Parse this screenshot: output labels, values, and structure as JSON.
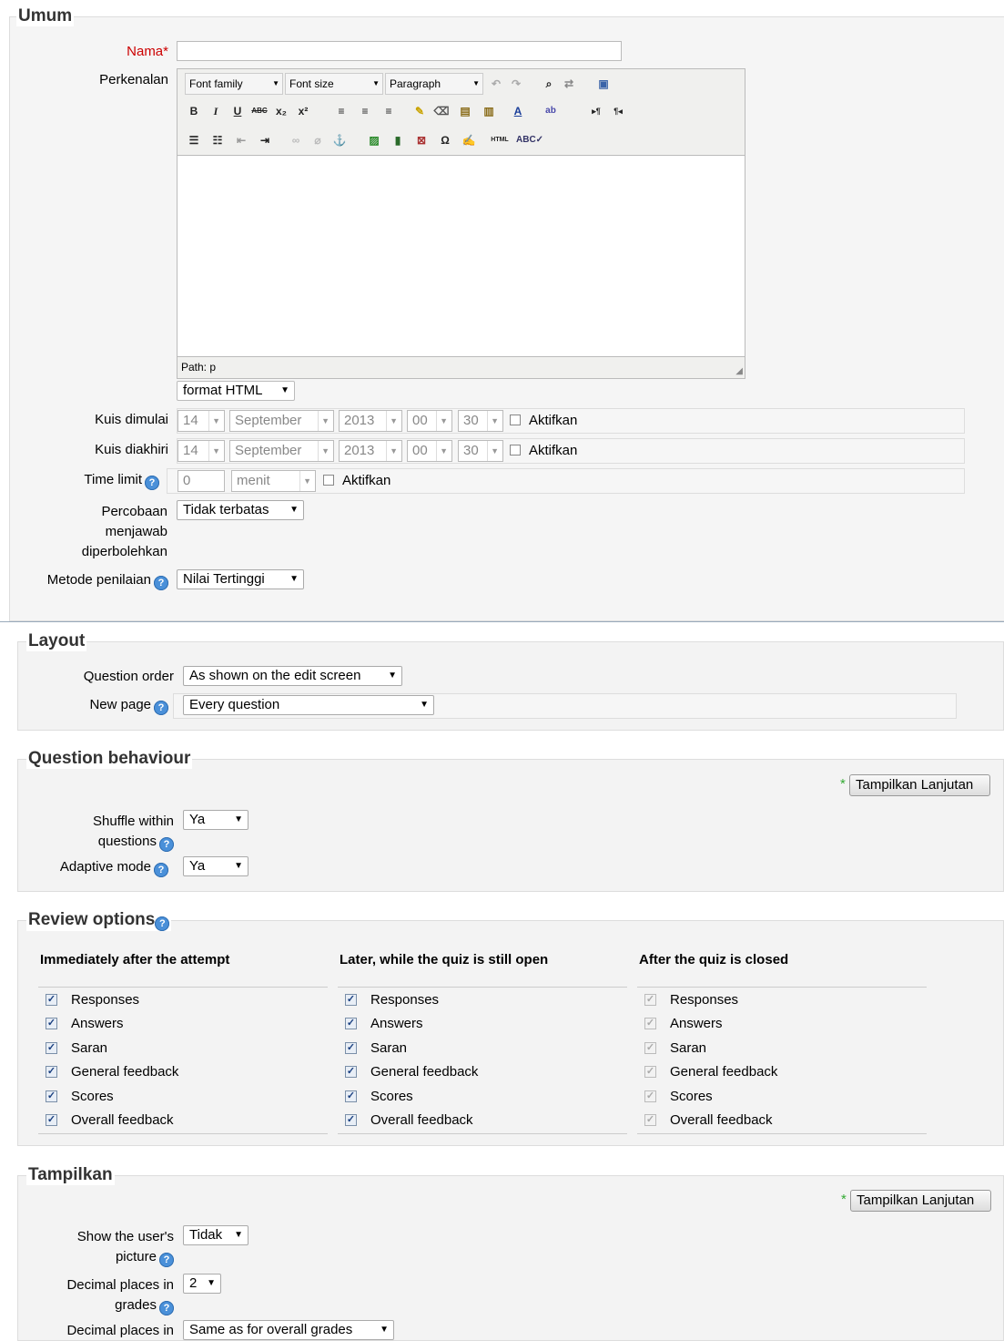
{
  "general": {
    "legend": "Umum",
    "name_label": "Nama",
    "name_required": "*",
    "intro_label": "Perkenalan",
    "editor": {
      "font_family": "Font family",
      "font_size": "Font size",
      "paragraph": "Paragraph",
      "path": "Path: p",
      "format": "format HTML"
    },
    "open_label": "Kuis dimulai",
    "close_label": "Kuis diakhiri",
    "date_open": {
      "day": "14",
      "month": "September",
      "year": "2013",
      "hour": "00",
      "minute": "30",
      "enable": "Aktifkan"
    },
    "date_close": {
      "day": "14",
      "month": "September",
      "year": "2013",
      "hour": "00",
      "minute": "30",
      "enable": "Aktifkan"
    },
    "time_limit_label": "Time limit",
    "time_limit_value": "0",
    "time_limit_unit": "menit",
    "time_limit_enable": "Aktifkan",
    "attempts_label_1": "Percobaan",
    "attempts_label_2": "menjawab",
    "attempts_label_3": "diperbolehkan",
    "attempts_value": "Tidak terbatas",
    "grading_label": "Metode penilaian",
    "grading_value": "Nilai Tertinggi"
  },
  "layout": {
    "legend": "Layout",
    "order_label": "Question order",
    "order_value": "As shown on the edit screen",
    "newpage_label": "New page",
    "newpage_value": "Every question"
  },
  "behaviour": {
    "legend": "Question behaviour",
    "advanced_star": "*",
    "advanced_button": "Tampilkan Lanjutan",
    "shuffle_label_1": "Shuffle within",
    "shuffle_label_2": "questions",
    "shuffle_value": "Ya",
    "adaptive_label": "Adaptive mode",
    "adaptive_value": "Ya"
  },
  "review": {
    "legend": "Review options",
    "columns": [
      {
        "title": "Immediately after the attempt",
        "disabled": false
      },
      {
        "title": "Later, while the quiz is still open",
        "disabled": false
      },
      {
        "title": "After the quiz is closed",
        "disabled": true
      }
    ],
    "items": [
      "Responses",
      "Answers",
      "Saran",
      "General feedback",
      "Scores",
      "Overall feedback"
    ]
  },
  "display": {
    "legend": "Tampilkan",
    "advanced_star": "*",
    "advanced_button": "Tampilkan Lanjutan",
    "picture_label_1": "Show the user's",
    "picture_label_2": "picture",
    "picture_value": "Tidak",
    "decimal_label_1": "Decimal places in",
    "decimal_label_2": "grades",
    "decimal_value": "2",
    "decimal_q_label": "Decimal places in",
    "decimal_q_value": "Same as for overall grades"
  },
  "colors": {
    "required": "#cc0000",
    "help": "#4a90d9",
    "accent_line": "#9ab"
  }
}
